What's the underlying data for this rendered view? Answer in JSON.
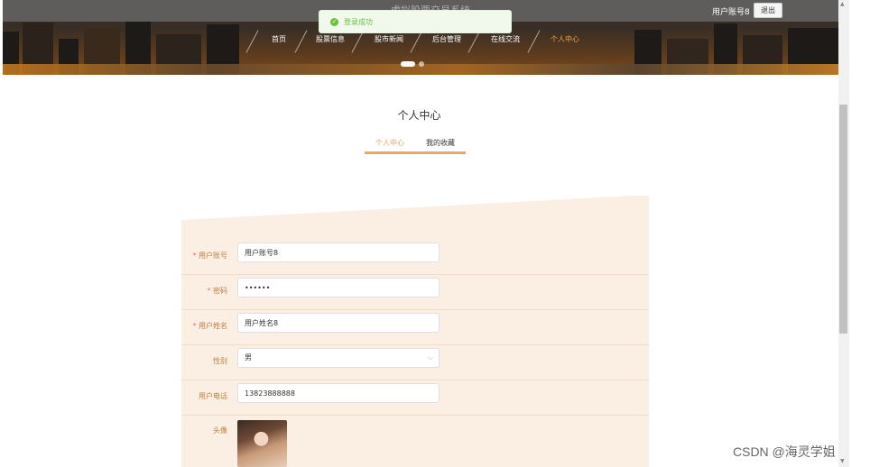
{
  "header": {
    "site_title": "虚拟股票交易系统",
    "user_account": "用户账号8",
    "logout_label": "退出"
  },
  "nav": {
    "items": [
      {
        "label": "首页"
      },
      {
        "label": "股票信息"
      },
      {
        "label": "股市新闻"
      },
      {
        "label": "后台管理"
      },
      {
        "label": "在线交流"
      },
      {
        "label": "个人中心"
      }
    ],
    "active_index": 5
  },
  "toast": {
    "message": "登录成功",
    "icon": "check-circle-icon",
    "color": "#67c23a"
  },
  "page": {
    "title": "个人中心",
    "tabs": [
      {
        "label": "个人中心",
        "active": true
      },
      {
        "label": "我的收藏",
        "active": false
      }
    ]
  },
  "form": {
    "account": {
      "label": "用户账号",
      "value": "用户账号8"
    },
    "password": {
      "label": "密码",
      "value": "••••••"
    },
    "name": {
      "label": "用户姓名",
      "value": "用户姓名8"
    },
    "gender": {
      "label": "性别",
      "value": "男"
    },
    "phone": {
      "label": "用户电话",
      "value": "13823888888"
    },
    "avatar": {
      "label": "头像"
    }
  },
  "required_mark": "*",
  "watermark": "CSDN @海灵学姐",
  "colors": {
    "accent": "#e3a25f",
    "panel_bg": "#fbefe4",
    "success": "#67c23a",
    "required": "#f56c6c"
  }
}
